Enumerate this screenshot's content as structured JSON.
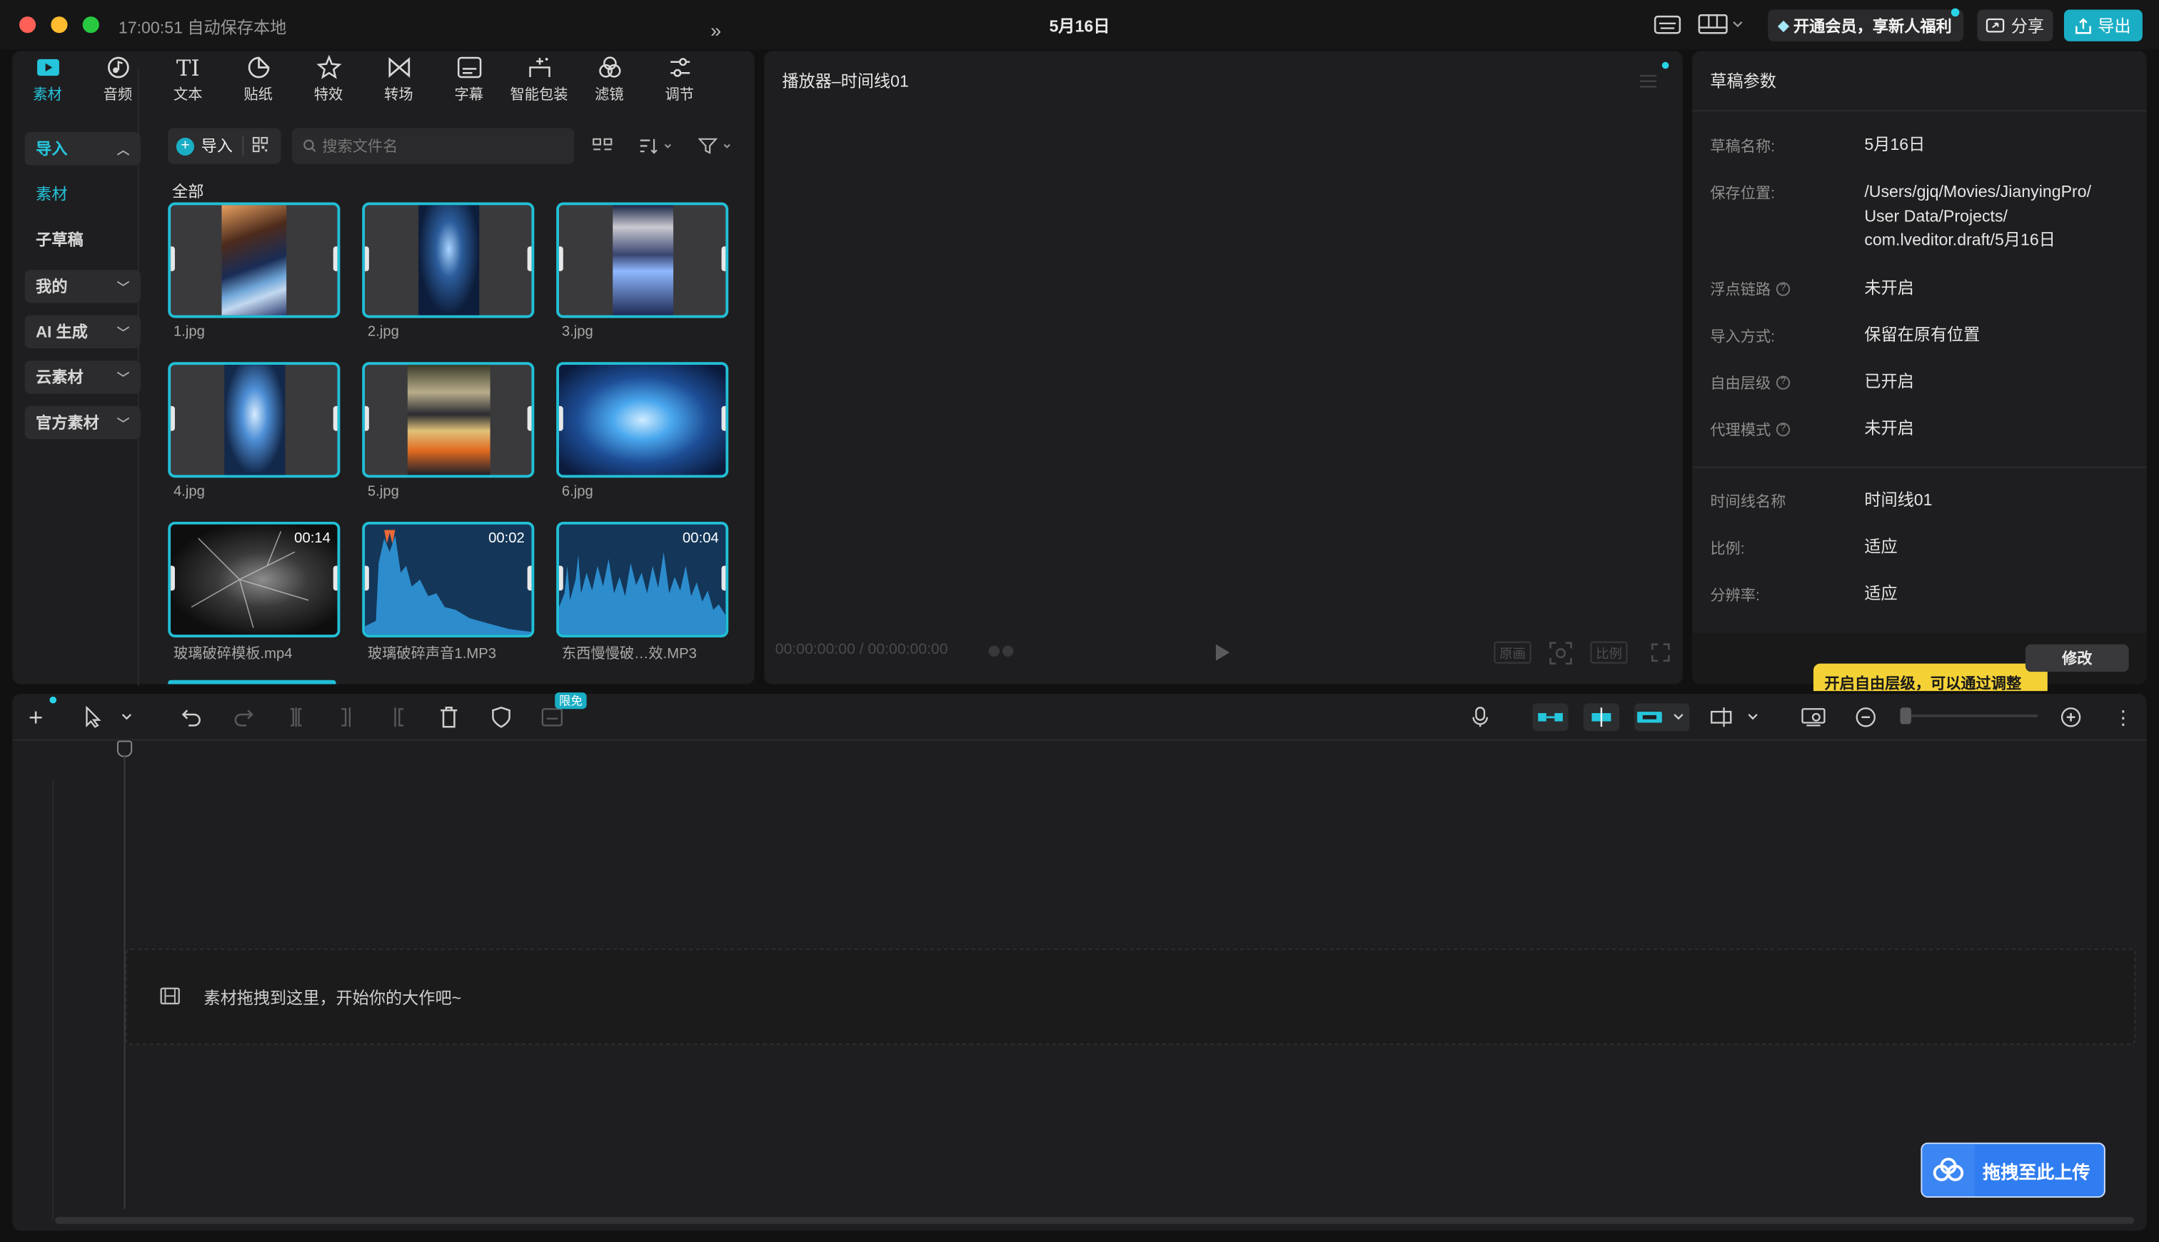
{
  "titlebar": {
    "time_status": "17:00:51 自动保存本地",
    "project_title": "5月16日",
    "vip_label": "开通会员，享新人福利",
    "share_label": "分享",
    "export_label": "导出"
  },
  "toolbar": {
    "tools": [
      {
        "label": "素材",
        "icon": "media-icon"
      },
      {
        "label": "音频",
        "icon": "audio-icon"
      },
      {
        "label": "文本",
        "icon": "text-icon"
      },
      {
        "label": "贴纸",
        "icon": "sticker-icon"
      },
      {
        "label": "特效",
        "icon": "effects-icon"
      },
      {
        "label": "转场",
        "icon": "transition-icon"
      },
      {
        "label": "字幕",
        "icon": "subtitle-icon"
      },
      {
        "label": "智能包装",
        "icon": "smart-pack-icon"
      },
      {
        "label": "滤镜",
        "icon": "filter-icon"
      },
      {
        "label": "调节",
        "icon": "adjust-icon"
      }
    ],
    "active_index": 0
  },
  "sidebar": {
    "items": [
      {
        "label": "导入"
      },
      {
        "label": "素材"
      },
      {
        "label": "子草稿"
      },
      {
        "label": "我的"
      },
      {
        "label": "AI 生成"
      },
      {
        "label": "云素材"
      },
      {
        "label": "官方素材"
      }
    ]
  },
  "media": {
    "import_label": "导入",
    "search_placeholder": "搜索文件名",
    "section_label": "全部",
    "items": [
      {
        "name": "1.jpg"
      },
      {
        "name": "2.jpg"
      },
      {
        "name": "3.jpg"
      },
      {
        "name": "4.jpg"
      },
      {
        "name": "5.jpg"
      },
      {
        "name": "6.jpg"
      },
      {
        "name": "玻璃破碎模板.mp4",
        "duration": "00:14"
      },
      {
        "name": "玻璃破碎声音1.MP3",
        "duration": "00:02"
      },
      {
        "name": "东西慢慢破…效.MP3",
        "duration": "00:04"
      }
    ]
  },
  "player": {
    "title": "播放器–时间线01",
    "timecode": "00:00:00:00 / 00:00:00:00",
    "original_label": "原画",
    "ratio_label": "比例"
  },
  "props": {
    "title": "草稿参数",
    "rows": [
      {
        "key": "草稿名称:",
        "value": "5月16日"
      },
      {
        "key": "保存位置:",
        "value": "/Users/gjq/Movies/JianyingPro/\nUser Data/Projects/\ncom.lveditor.draft/5月16日"
      },
      {
        "key": "浮点链路",
        "value": "未开启"
      },
      {
        "key": "导入方式:",
        "value": "保留在原有位置"
      },
      {
        "key": "自由层级",
        "value": "已开启"
      },
      {
        "key": "代理模式",
        "value": "未开启"
      },
      {
        "key": "时间线名称",
        "value": "时间线01"
      },
      {
        "key": "比例:",
        "value": "适应"
      },
      {
        "key": "分辨率:",
        "value": "适应"
      }
    ],
    "modify_label": "修改",
    "tip_text": "开启自由层级，可以通过调整"
  },
  "timeline": {
    "free_badge": "限免",
    "drop_hint": "素材拖拽到这里，开始你的大作吧~"
  },
  "upload": {
    "label": "拖拽至此上传"
  },
  "colors": {
    "accent": "#22bfd6",
    "export": "#1aaec5",
    "upload": "#2f7df0",
    "tip": "#f4d236"
  }
}
